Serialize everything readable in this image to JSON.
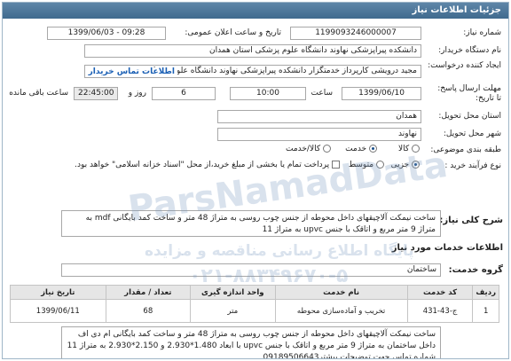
{
  "header": {
    "title": "جزئیات اطلاعات نیاز"
  },
  "form": {
    "need_number_label": "شماره نیاز:",
    "need_number": "1199093246000007",
    "announce_date_label": "تاریخ و ساعت اعلان عمومی:",
    "announce_date": "1399/06/03 - 09:28",
    "buyer_org_label": "نام دستگاه خریدار:",
    "buyer_org": "دانشکده پیراپزشکی نهاوند دانشگاه علوم پزشکی استان همدان",
    "requester_label": "ایجاد کننده درخواست:",
    "requester": "مجید درویشی کارپرداز خدمتگزار دانشکده پیراپزشکی نهاوند دانشگاه علوم پزشکی",
    "buyer_contact_link": "اطلاعات تماس خریدار",
    "deadline_label": "مهلت ارسال پاسخ:",
    "deadline_sub_label": "تا تاریخ:",
    "deadline_date": "1399/06/10",
    "time_label": "ساعت",
    "deadline_time": "10:00",
    "days_value": "6",
    "days_label": "روز و",
    "remaining_time": "22:45:00",
    "remaining_label": "ساعت باقی مانده",
    "province_label": "استان محل تحویل:",
    "province": "همدان",
    "city_label": "شهر محل تحویل:",
    "city": "نهاوند",
    "category_label": "طبقه بندی موضوعی:",
    "category_options": [
      "کالا",
      "خدمت",
      "کالا/خدمت"
    ],
    "category_selected": "خدمت",
    "purchase_type_label": "نوع فرآیند خرید :",
    "purchase_options": [
      "جزیی",
      "متوسط"
    ],
    "purchase_selected": "جزیی",
    "payment_note": "پرداخت تمام یا بخشی از مبلغ خرید،از محل \"اسناد خزانه اسلامی\" خواهد بود."
  },
  "summary": {
    "label": "شرح کلی نیاز:",
    "text": "ساخت نیمکت آلاچیقهای داخل محوطه از جنس چوب روسی به متراژ 48 متر  و ساخت کمد بایگانی mdf به متراژ 9 متر مربع و اتاقک با جنس upvc به متراژ 11"
  },
  "services": {
    "section_title": "اطلاعات خدمات مورد نیاز",
    "group_label": "گروه خدمت:",
    "group_value": "ساختمان",
    "columns": [
      "ردیف",
      "کد خدمت",
      "نام خدمت",
      "واحد اندازه گیری",
      "تعداد / مقدار",
      "تاریخ نیاز"
    ],
    "rows": [
      {
        "index": "1",
        "code": "ج-43-431",
        "name": "تخریب و آماده‌سازی محوطه",
        "unit": "متر",
        "qty": "68",
        "date": "1399/06/11"
      }
    ],
    "description": "ساخت نیمکت آلاچیقهای داخل محوطه از جنس چوب روسی به متراژ 48 متر  و ساخت کمد بایگانی ام دی اف داخل ساختمان به متراژ 9 متر مربع و اتاقک با جنس upvc با ابعاد 1.480*2.930 و 2.150*2.930 به متراژ 11 شماره تماس  جهت توضیحات بیشتر09189506643"
  },
  "watermark": {
    "line1": "ParsNamadData",
    "line2": "پایگاه اطلاع رسانی مناقصه و مزایده",
    "line3": "۰۲۱-۸۸۳۴۹۶۷۰-۵"
  }
}
